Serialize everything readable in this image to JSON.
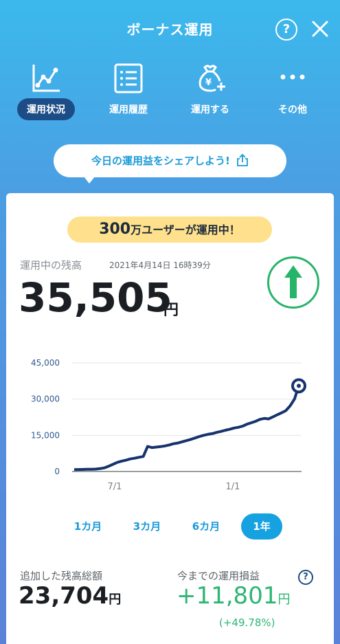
{
  "header": {
    "title": "ボーナス運用",
    "help_label": "?"
  },
  "nav": {
    "items": [
      {
        "label": "運用状況",
        "icon": "line-chart-icon",
        "active": true
      },
      {
        "label": "運用履歴",
        "icon": "list-icon",
        "active": false
      },
      {
        "label": "運用する",
        "icon": "yen-bag-plus-icon",
        "active": false
      },
      {
        "label": "その他",
        "icon": "more-dots-icon",
        "active": false
      }
    ]
  },
  "share": {
    "label": "今日の運用益をシェアしよう!",
    "icon": "share-icon"
  },
  "card": {
    "badge_number": "300",
    "badge_text": "万ユーザーが運用中！",
    "balance_label": "運用中の残高",
    "balance_date": "2021年4月14日 16時39分",
    "balance_value": "35,505",
    "balance_unit": "円",
    "trend_icon": "up-arrow-icon"
  },
  "chart_data": {
    "type": "line",
    "y_ticks": [
      "45,000",
      "30,000",
      "15,000",
      "0"
    ],
    "ylim": [
      0,
      45000
    ],
    "x_ticks": [
      "7/1",
      "1/1"
    ],
    "series": [
      {
        "values": [
          800,
          820,
          850,
          900,
          950,
          1000,
          1200,
          1500,
          2200,
          3000,
          3800,
          4300,
          4700,
          5200,
          5500,
          5900,
          6200,
          10400,
          9900,
          10100,
          10300,
          10600,
          11000,
          11500,
          11800,
          12300,
          12800,
          13300,
          13900,
          14500,
          15000,
          15400,
          15700,
          16200,
          16600,
          17100,
          17500,
          18000,
          18300,
          18800,
          19600,
          20200,
          20800,
          21600,
          22000,
          21800,
          22600,
          23500,
          24300,
          25200,
          27200,
          30000,
          35500
        ]
      }
    ],
    "color": "#17336e"
  },
  "periods": {
    "tabs": [
      {
        "label": "1カ月",
        "active": false
      },
      {
        "label": "3カ月",
        "active": false
      },
      {
        "label": "6カ月",
        "active": false
      },
      {
        "label": "1年",
        "active": true
      }
    ]
  },
  "stats": {
    "added_label": "追加した残高総額",
    "added_value": "23,704",
    "added_unit": "円",
    "profit_label": "今までの運用損益",
    "profit_value": "+11,801",
    "profit_unit": "円",
    "profit_pct": "(+49.78%)",
    "help_label": "?"
  },
  "colors": {
    "accent": "#1a9ad8",
    "nav_active": "#1d4d86",
    "profit": "#2bb673",
    "badge": "#ffe08c"
  }
}
